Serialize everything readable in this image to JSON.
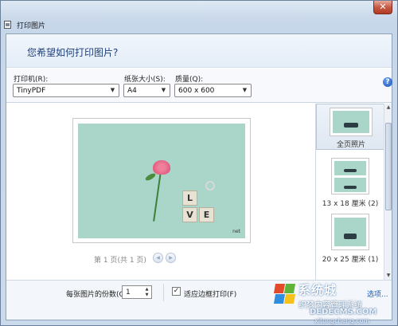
{
  "window": {
    "title": "打印图片",
    "close_symbol": "✕"
  },
  "header": {
    "heading": "您希望如何打印图片?"
  },
  "options": {
    "printer_label": "打印机(R):",
    "printer_value": "TinyPDF",
    "paper_label": "纸张大小(S):",
    "paper_value": "A4",
    "quality_label": "质量(Q):",
    "quality_value": "600 x 600",
    "help_symbol": "?"
  },
  "preview": {
    "tiles": [
      "L",
      "V",
      "E"
    ],
    "photo_caption": "net",
    "page_info": "第 1 页(共 1 页)",
    "prev_symbol": "◀",
    "next_symbol": "▶"
  },
  "layouts": [
    {
      "label": "全页照片",
      "selected": true
    },
    {
      "label": "13 x 18 厘米 (2)",
      "selected": false
    },
    {
      "label": "20 x 25 厘米 (1)",
      "selected": false
    }
  ],
  "bottom": {
    "copies_label": "每张图片的份数(C):",
    "copies_value": "1",
    "fit_checked": true,
    "fit_label": "适应边框打印(F)",
    "options_link": "选项..."
  },
  "watermark": {
    "line1": "系统城",
    "line2": "织梦内容管理系统",
    "line3": "DEDECMS.COM",
    "line4": "xitongcheng.com"
  },
  "colors": {
    "accent_text": "#1f3f78",
    "link": "#1a5fb4",
    "photo_bg": "#a9d6c8"
  }
}
